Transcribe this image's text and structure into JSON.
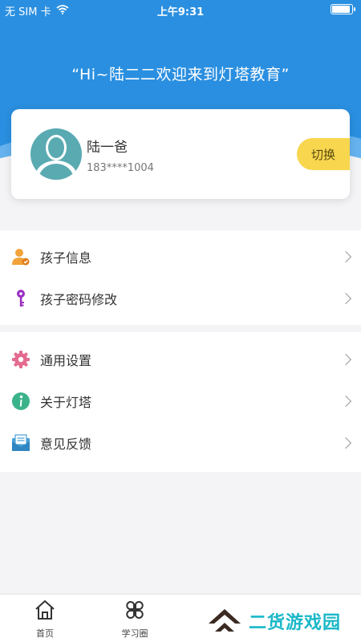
{
  "status_bar": {
    "carrier": "无 SIM 卡",
    "time": "上午9:31",
    "battery_level": 0.95
  },
  "header": {
    "welcome": "“Hi~陆二二欢迎来到灯塔教育”"
  },
  "profile": {
    "name": "陆一爸",
    "phone": "183****1004",
    "switch_label": "切换",
    "avatar_icon": "user-avatar-icon"
  },
  "menu_group_1": [
    {
      "label": "孩子信息",
      "icon": "child-profile-icon"
    },
    {
      "label": "孩子密码修改",
      "icon": "key-icon"
    }
  ],
  "menu_group_2": [
    {
      "label": "通用设置",
      "icon": "gear-icon"
    },
    {
      "label": "关于灯塔",
      "icon": "info-icon"
    },
    {
      "label": "意见反馈",
      "icon": "feedback-envelope-icon"
    }
  ],
  "tabbar": [
    {
      "label": "首页",
      "icon": "home-icon"
    },
    {
      "label": "学习圈",
      "icon": "clover-icon"
    }
  ],
  "watermark": {
    "text": "二货游戏园"
  },
  "colors": {
    "header_blue": "#2a8fe0",
    "switch_yellow": "#f8d64e",
    "avatar_teal": "#5aaab2"
  }
}
